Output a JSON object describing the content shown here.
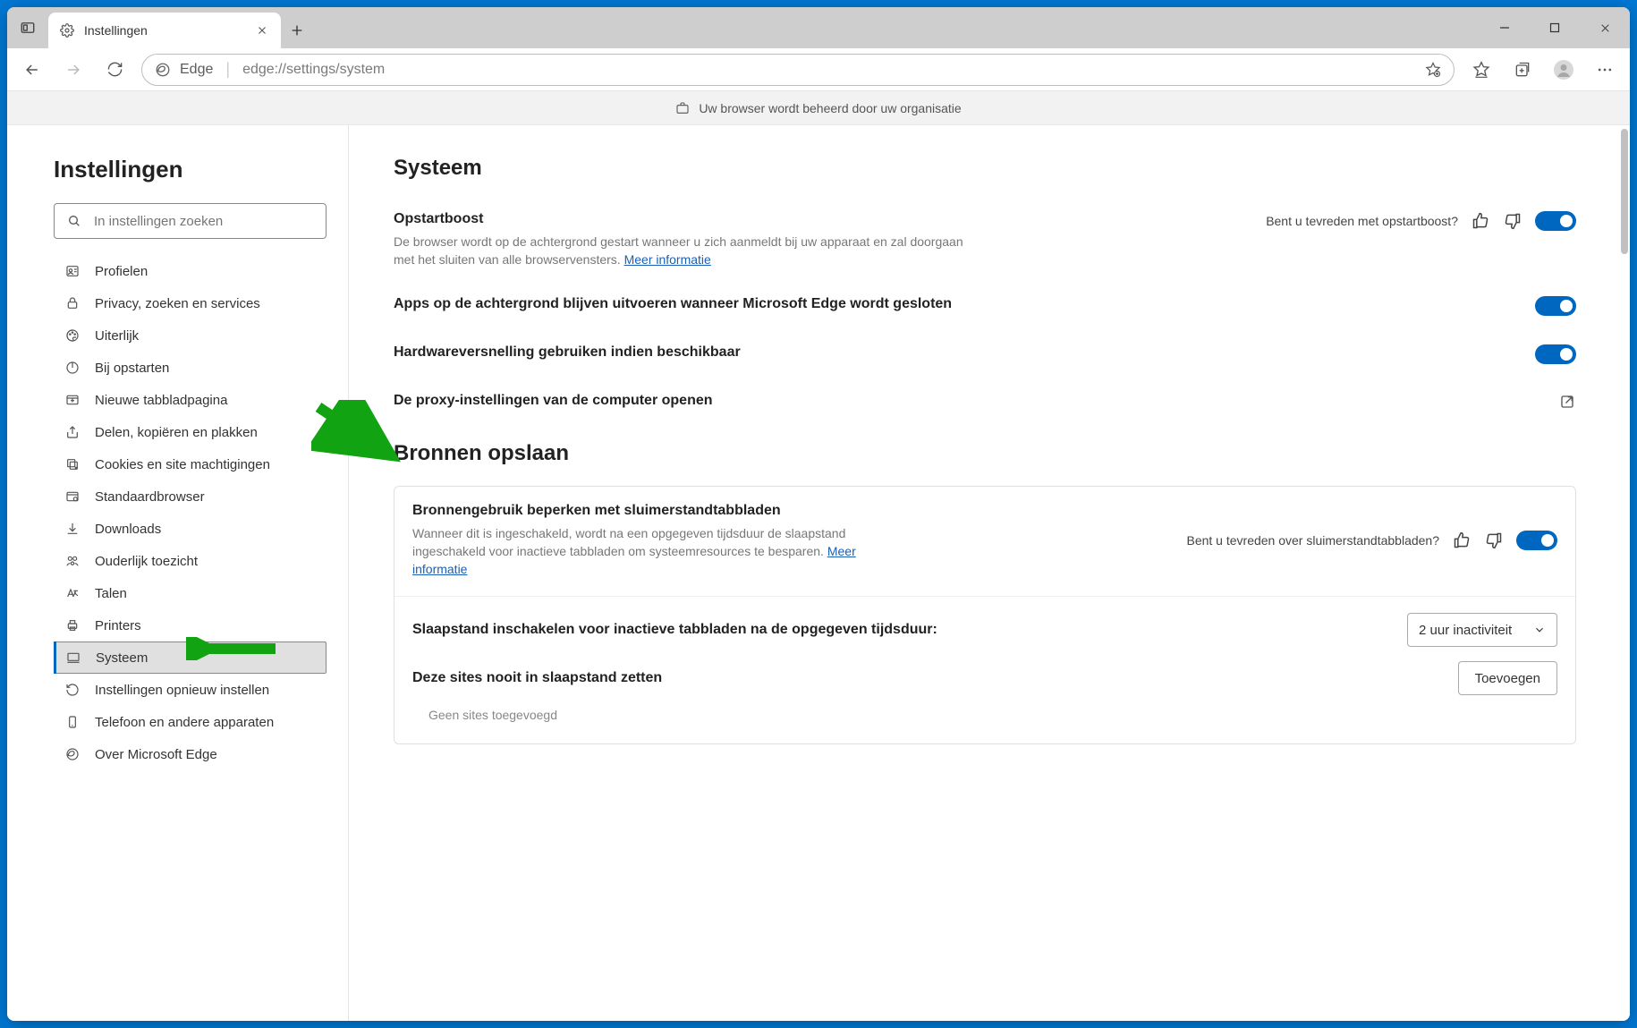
{
  "tab": {
    "title": "Instellingen"
  },
  "address": {
    "prefix": "Edge",
    "url": "edge://settings/system"
  },
  "managed_notice": "Uw browser wordt beheerd door uw organisatie",
  "sidebar": {
    "heading": "Instellingen",
    "search_placeholder": "In instellingen zoeken",
    "items": [
      {
        "label": "Profielen",
        "icon": "profile-icon"
      },
      {
        "label": "Privacy, zoeken en services",
        "icon": "lock-icon"
      },
      {
        "label": "Uiterlijk",
        "icon": "appearance-icon"
      },
      {
        "label": "Bij opstarten",
        "icon": "power-icon"
      },
      {
        "label": "Nieuwe tabbladpagina",
        "icon": "newtab-icon"
      },
      {
        "label": "Delen, kopiëren en plakken",
        "icon": "share-icon"
      },
      {
        "label": "Cookies en site machtigingen",
        "icon": "cookies-icon"
      },
      {
        "label": "Standaardbrowser",
        "icon": "default-browser-icon"
      },
      {
        "label": "Downloads",
        "icon": "download-icon"
      },
      {
        "label": "Ouderlijk toezicht",
        "icon": "family-icon"
      },
      {
        "label": "Talen",
        "icon": "languages-icon"
      },
      {
        "label": "Printers",
        "icon": "printer-icon"
      },
      {
        "label": "Systeem",
        "icon": "system-icon",
        "selected": true
      },
      {
        "label": "Instellingen opnieuw instellen",
        "icon": "reset-icon"
      },
      {
        "label": "Telefoon en andere apparaten",
        "icon": "phone-icon"
      },
      {
        "label": "Over Microsoft Edge",
        "icon": "about-icon"
      }
    ]
  },
  "main": {
    "section1_title": "Systeem",
    "startup_boost": {
      "title": "Opstartboost",
      "desc": "De browser wordt op de achtergrond gestart wanneer u zich aanmeldt bij uw apparaat en zal doorgaan met het sluiten van alle browservensters. ",
      "more": "Meer informatie",
      "feedback_q": "Bent u tevreden met opstartboost?"
    },
    "background_apps": {
      "title": "Apps op de achtergrond blijven uitvoeren wanneer Microsoft Edge wordt gesloten"
    },
    "hw_accel": {
      "title": "Hardwareversnelling gebruiken indien beschikbaar"
    },
    "proxy": {
      "title": "De proxy-instellingen van de computer openen"
    },
    "section2_title": "Bronnen opslaan",
    "sleep_tabs": {
      "title": "Bronnengebruik beperken met sluimerstandtabbladen",
      "desc": "Wanneer dit is ingeschakeld, wordt na een opgegeven tijdsduur de slaapstand ingeschakeld voor inactieve tabbladen om systeemresources te besparen. ",
      "more": "Meer informatie",
      "feedback_q": "Bent u tevreden over sluimerstandtabbladen?"
    },
    "sleep_after": {
      "title": "Slaapstand inschakelen voor inactieve tabbladen na de opgegeven tijdsduur:",
      "value": "2 uur inactiviteit"
    },
    "never_sleep": {
      "title": "Deze sites nooit in slaapstand zetten",
      "add_label": "Toevoegen",
      "empty": "Geen sites toegevoegd"
    }
  }
}
